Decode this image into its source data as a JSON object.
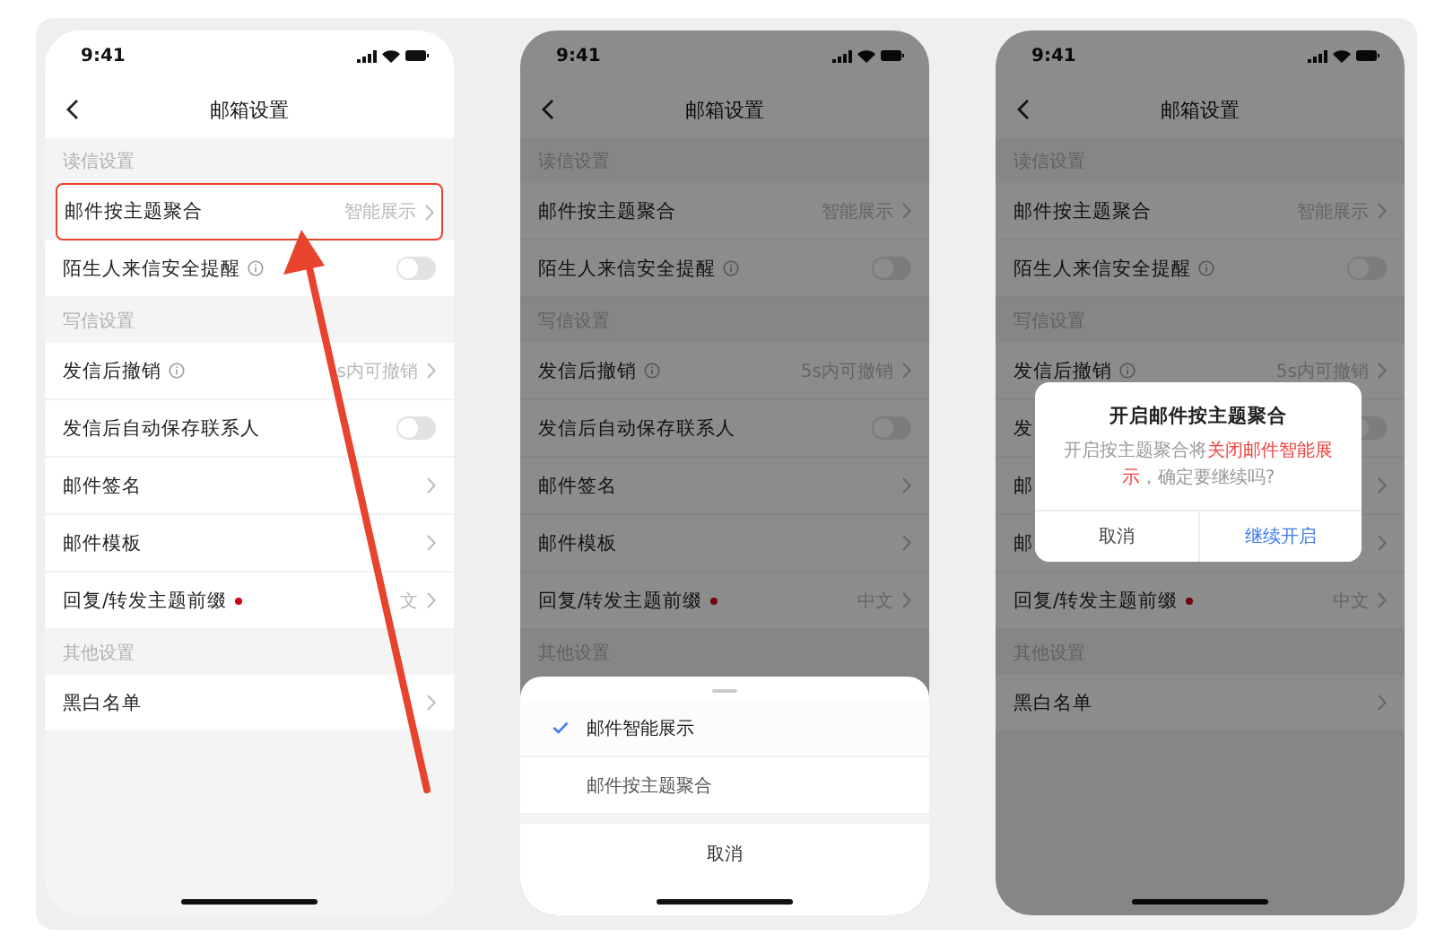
{
  "phones": [
    {
      "time": "9:41",
      "title": "邮箱设置",
      "arrow": true,
      "sections": [
        {
          "header": "读信设置",
          "rows": [
            {
              "label": "邮件按主题聚合",
              "kind": "link",
              "value": "智能展示",
              "highlighted": true
            },
            {
              "label": "陌生人来信安全提醒",
              "kind": "toggle",
              "info": true,
              "on": false
            }
          ]
        },
        {
          "header": "写信设置",
          "rows": [
            {
              "label": "发信后撤销",
              "kind": "link",
              "info": true,
              "value": "s内可撤销"
            },
            {
              "label": "发信后自动保存联系人",
              "kind": "toggle",
              "on": false
            },
            {
              "label": "邮件签名",
              "kind": "link"
            },
            {
              "label": "邮件模板",
              "kind": "link"
            },
            {
              "label": "回复/转发主题前缀",
              "kind": "link",
              "badge": true,
              "value": "文"
            }
          ]
        },
        {
          "header": "其他设置",
          "rows": [
            {
              "label": "黑白名单",
              "kind": "link"
            }
          ]
        }
      ]
    },
    {
      "time": "9:41",
      "title": "邮箱设置",
      "sections": [
        {
          "header": "读信设置",
          "rows": [
            {
              "label": "邮件按主题聚合",
              "kind": "link",
              "value": "智能展示"
            },
            {
              "label": "陌生人来信安全提醒",
              "kind": "toggle",
              "info": true,
              "on": false
            }
          ]
        },
        {
          "header": "写信设置",
          "rows": [
            {
              "label": "发信后撤销",
              "kind": "link",
              "info": true,
              "value": "5s内可撤销"
            },
            {
              "label": "发信后自动保存联系人",
              "kind": "toggle",
              "on": false
            },
            {
              "label": "邮件签名",
              "kind": "link"
            },
            {
              "label": "邮件模板",
              "kind": "link"
            },
            {
              "label": "回复/转发主题前缀",
              "kind": "link",
              "badge": true,
              "value": "中文"
            }
          ]
        },
        {
          "header": "其他设置"
        }
      ],
      "sheet": {
        "options": [
          {
            "label": "邮件智能展示",
            "selected": true
          },
          {
            "label": "邮件按主题聚合",
            "selected": false
          }
        ],
        "cancel": "取消"
      }
    },
    {
      "time": "9:41",
      "title": "邮箱设置",
      "sections": [
        {
          "header": "读信设置",
          "rows": [
            {
              "label": "邮件按主题聚合",
              "kind": "link",
              "value": "智能展示"
            },
            {
              "label": "陌生人来信安全提醒",
              "kind": "toggle",
              "info": true,
              "on": false
            }
          ]
        },
        {
          "header": "写信设置",
          "rows": [
            {
              "label": "发信后撤销",
              "kind": "link",
              "info": true,
              "value": "5s内可撤销"
            },
            {
              "label": "发",
              "kind": "toggle",
              "on": false
            },
            {
              "label": "邮",
              "kind": "link"
            },
            {
              "label": "邮",
              "kind": "link"
            },
            {
              "label": "回复/转发主题前缀",
              "kind": "link",
              "badge": true,
              "value": "中文"
            }
          ]
        },
        {
          "header": "其他设置",
          "rows": [
            {
              "label": "黑白名单",
              "kind": "link"
            }
          ]
        }
      ],
      "dialog": {
        "title": "开启邮件按主题聚合",
        "message": [
          {
            "text": "开启按主题聚合将",
            "emphasis": false
          },
          {
            "text": "关闭邮件智能展示",
            "emphasis": true
          },
          {
            "text": "，确定要继续吗?",
            "emphasis": false
          }
        ],
        "cancel": "取消",
        "confirm": "继续开启"
      }
    }
  ]
}
